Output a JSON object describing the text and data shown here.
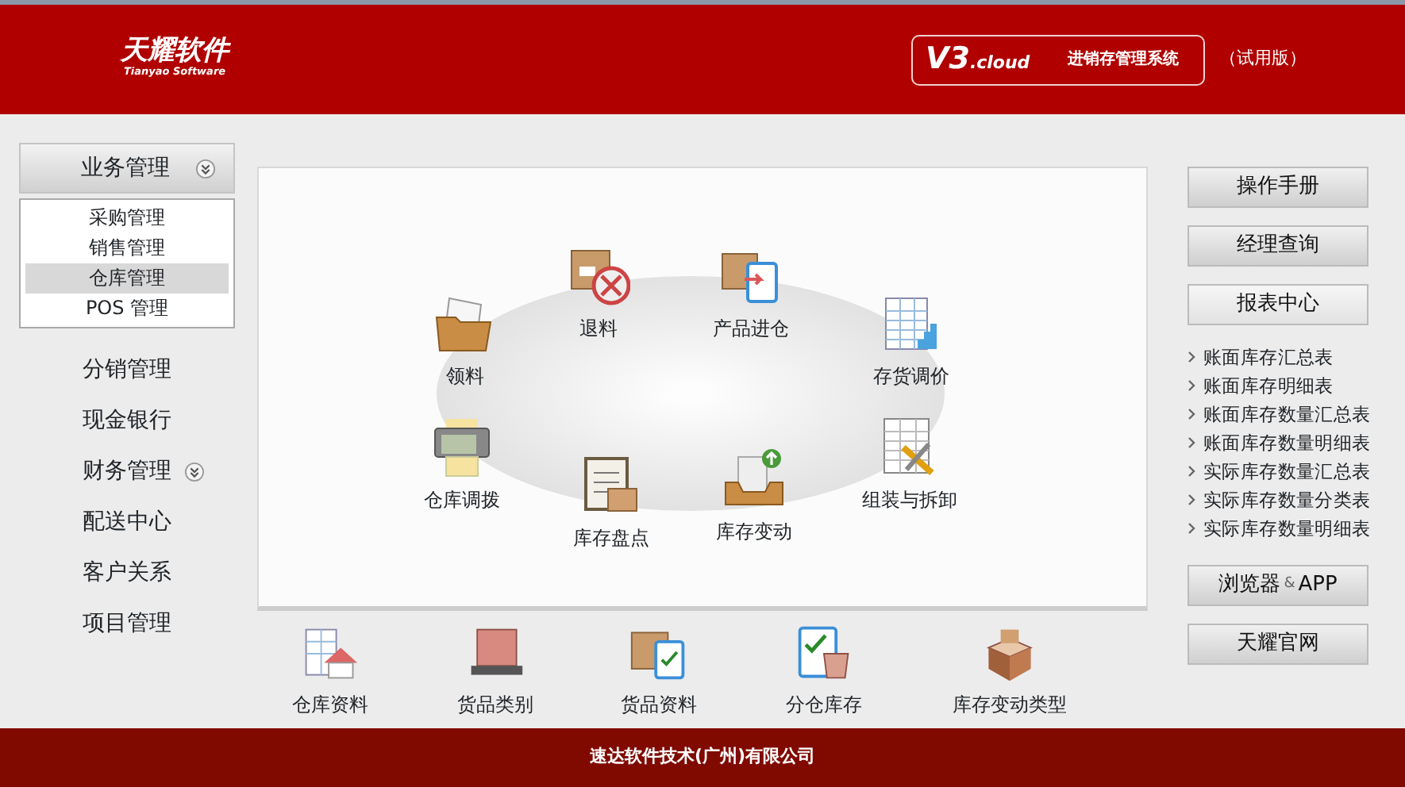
{
  "header": {
    "logo": "天耀软件",
    "logo_sub": "Tianyao Software",
    "version": "V3",
    "version_suffix": ".cloud",
    "system": "进销存管理系统",
    "edition": "（试用版）"
  },
  "sidebar": {
    "items": [
      {
        "label": "业务管理",
        "kind": "group",
        "expanded": true,
        "children": [
          {
            "label": "采购管理",
            "selected": false
          },
          {
            "label": "销售管理",
            "selected": false
          },
          {
            "label": "仓库管理",
            "selected": true
          },
          {
            "label": "POS 管理",
            "selected": false
          }
        ]
      },
      {
        "label": "分销管理",
        "kind": "plain"
      },
      {
        "label": "现金银行",
        "kind": "plain"
      },
      {
        "label": "财务管理",
        "kind": "group",
        "expanded": false
      },
      {
        "label": "配送中心",
        "kind": "plain"
      },
      {
        "label": "客户关系",
        "kind": "plain"
      },
      {
        "label": "项目管理",
        "kind": "plain"
      }
    ]
  },
  "workflow": {
    "items": [
      {
        "label": "退料"
      },
      {
        "label": "产品进仓"
      },
      {
        "label": "领料"
      },
      {
        "label": "存货调价"
      },
      {
        "label": "仓库调拨"
      },
      {
        "label": "组装与拆卸"
      },
      {
        "label": "库存盘点"
      },
      {
        "label": "库存变动"
      }
    ]
  },
  "shortcuts": [
    {
      "label": "仓库资料"
    },
    {
      "label": "货品类别"
    },
    {
      "label": "货品资料"
    },
    {
      "label": "分仓库存"
    },
    {
      "label": "库存变动类型"
    }
  ],
  "right_panel": {
    "buttons": [
      "操作手册",
      "经理查询",
      "报表中心"
    ],
    "reports": [
      "账面库存汇总表",
      "账面库存明细表",
      "账面库存数量汇总表",
      "账面库存数量明细表",
      "实际库存数量汇总表",
      "实际库存数量分类表",
      "实际库存数量明细表"
    ],
    "bottom_buttons": [
      {
        "label": "浏览器",
        "suffix": "&",
        "extra": "APP"
      },
      {
        "label": "天耀官网"
      }
    ]
  },
  "footer": "速达软件技术(广州)有限公司"
}
